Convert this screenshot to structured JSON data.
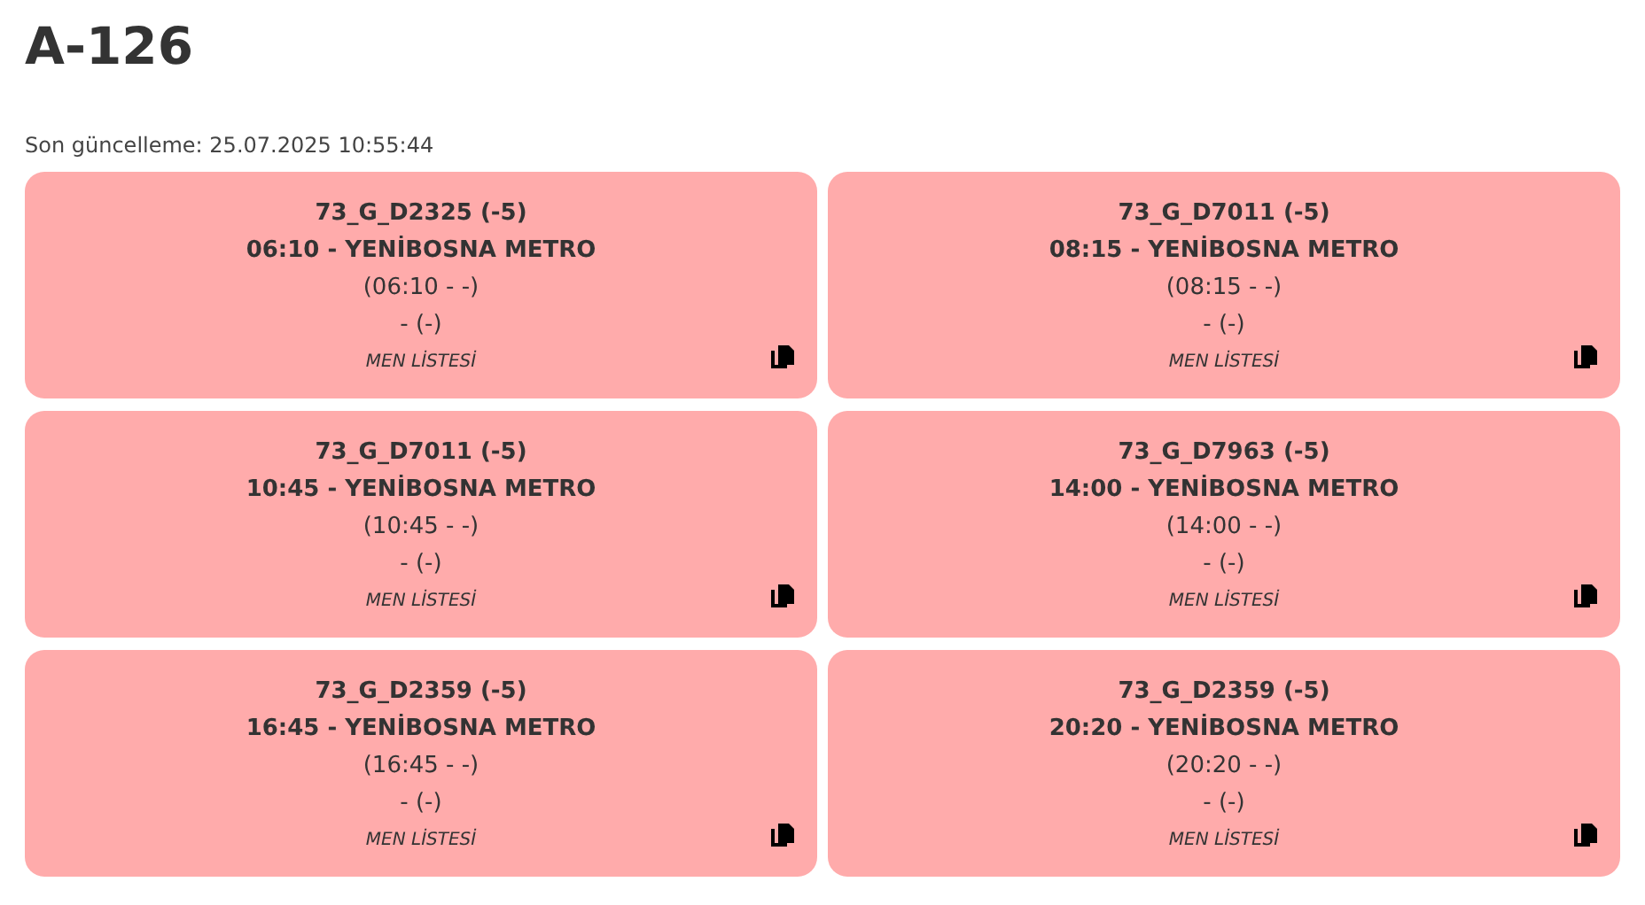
{
  "title": "A-126",
  "last_update": "Son güncelleme: 25.07.2025 10:55:44",
  "cards": [
    {
      "code": "73_G_D2325 (-5)",
      "departure": "06:10 - YENİBOSNA METRO",
      "times": "(06:10 - -)",
      "detail": "- (-)",
      "link": "MEN LİSTESİ"
    },
    {
      "code": "73_G_D7011 (-5)",
      "departure": "08:15 - YENİBOSNA METRO",
      "times": "(08:15 - -)",
      "detail": "- (-)",
      "link": "MEN LİSTESİ"
    },
    {
      "code": "73_G_D7011 (-5)",
      "departure": "10:45 - YENİBOSNA METRO",
      "times": "(10:45 - -)",
      "detail": "- (-)",
      "link": "MEN LİSTESİ"
    },
    {
      "code": "73_G_D7963 (-5)",
      "departure": "14:00 - YENİBOSNA METRO",
      "times": "(14:00 - -)",
      "detail": "- (-)",
      "link": "MEN LİSTESİ"
    },
    {
      "code": "73_G_D2359 (-5)",
      "departure": "16:45 - YENİBOSNA METRO",
      "times": "(16:45 - -)",
      "detail": "- (-)",
      "link": "MEN LİSTESİ"
    },
    {
      "code": "73_G_D2359 (-5)",
      "departure": "20:20 - YENİBOSNA METRO",
      "times": "(20:20 - -)",
      "detail": "- (-)",
      "link": "MEN LİSTESİ"
    }
  ]
}
